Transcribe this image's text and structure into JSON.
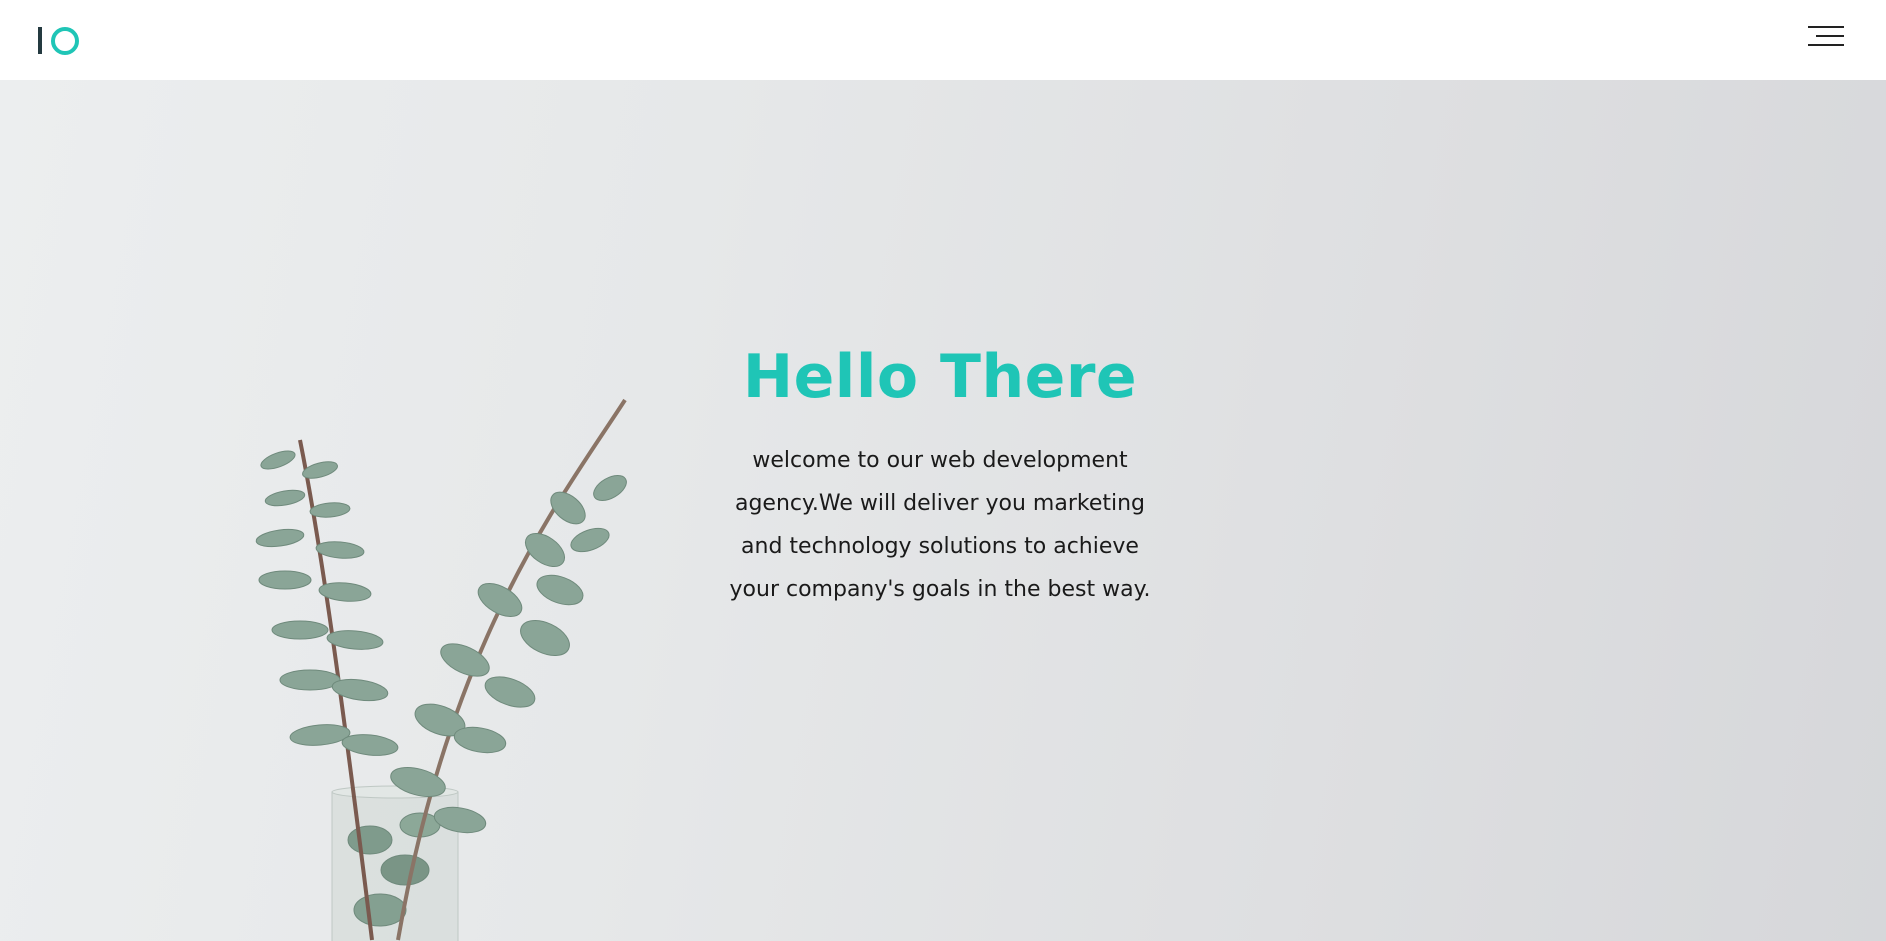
{
  "header": {
    "logo_icon": "io-logo-icon",
    "menu_icon": "hamburger-menu-icon"
  },
  "hero": {
    "title": "Hello There",
    "description": "welcome to our web development agency.We will deliver you marketing and technology solutions to achieve your company's goals in the best way.",
    "background_image": "eucalyptus-plant-in-glass-vase",
    "colors": {
      "accent": "#1fc5b6",
      "logo_dark": "#243a40",
      "text": "#1a1a1a"
    }
  }
}
